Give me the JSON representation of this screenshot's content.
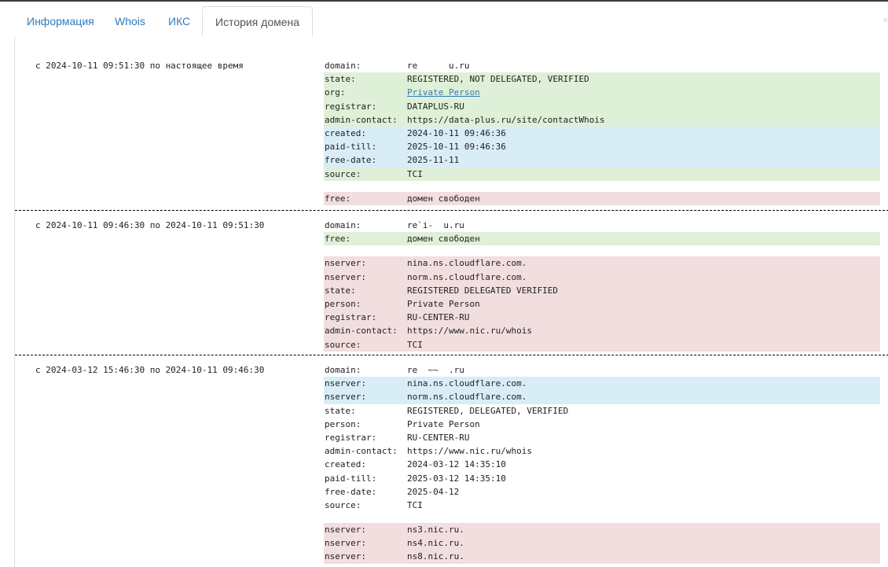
{
  "tabs": [
    {
      "label": "Информация",
      "active": false
    },
    {
      "label": "Whois",
      "active": false
    },
    {
      "label": "ИКС",
      "active": false
    },
    {
      "label": "История домена",
      "active": true
    }
  ],
  "close_label": "×",
  "colors": {
    "added": "#dff0d8",
    "changed": "#d9edf7",
    "removed": "#f2dede",
    "link": "#337ab7"
  },
  "periods": [
    {
      "range": "с 2024-10-11 09:51:30 по настоящее время",
      "groups": [
        {
          "rows": [
            {
              "key": "domain:",
              "value": "re      u.ru",
              "hl": ""
            },
            {
              "key": "state:",
              "value": "REGISTERED, NOT DELEGATED, VERIFIED",
              "hl": "g"
            },
            {
              "key": "org:",
              "value": "Private Person",
              "hl": "g",
              "link": true
            },
            {
              "key": "registrar:",
              "value": "DATAPLUS-RU",
              "hl": "g"
            },
            {
              "key": "admin-contact:",
              "value": "https://data-plus.ru/site/contactWhois",
              "hl": "g"
            },
            {
              "key": "created:",
              "value": "2024-10-11 09:46:36",
              "hl": "b"
            },
            {
              "key": "paid-till:",
              "value": "2025-10-11 09:46:36",
              "hl": "b"
            },
            {
              "key": "free-date:",
              "value": "2025-11-11",
              "hl": "b"
            },
            {
              "key": "source:",
              "value": "TCI",
              "hl": "g"
            }
          ]
        },
        {
          "rows": [
            {
              "key": "free:",
              "value": "домен свободен",
              "hl": "r"
            }
          ]
        }
      ]
    },
    {
      "range": "с 2024-10-11 09:46:30 по 2024-10-11 09:51:30",
      "groups": [
        {
          "rows": [
            {
              "key": "domain:",
              "value": "re`i-  u.ru",
              "hl": ""
            },
            {
              "key": "free:",
              "value": "домен свободен",
              "hl": "g"
            }
          ]
        },
        {
          "rows": [
            {
              "key": "nserver:",
              "value": "nina.ns.cloudflare.com.",
              "hl": "r"
            },
            {
              "key": "nserver:",
              "value": "norm.ns.cloudflare.com.",
              "hl": "r"
            },
            {
              "key": "state:",
              "value": "REGISTERED DELEGATED VERIFIED",
              "hl": "r"
            },
            {
              "key": "person:",
              "value": "Private Person",
              "hl": "r"
            },
            {
              "key": "registrar:",
              "value": "RU-CENTER-RU",
              "hl": "r"
            },
            {
              "key": "admin-contact:",
              "value": "https://www.nic.ru/whois",
              "hl": "r"
            },
            {
              "key": "source:",
              "value": "TCI",
              "hl": "r"
            }
          ]
        }
      ]
    },
    {
      "range": "с 2024-03-12 15:46:30 по 2024-10-11 09:46:30",
      "groups": [
        {
          "rows": [
            {
              "key": "domain:",
              "value": "re  ~~  .ru",
              "hl": ""
            },
            {
              "key": "nserver:",
              "value": "nina.ns.cloudflare.com.",
              "hl": "b"
            },
            {
              "key": "nserver:",
              "value": "norm.ns.cloudflare.com.",
              "hl": "b"
            },
            {
              "key": "state:",
              "value": "REGISTERED, DELEGATED, VERIFIED",
              "hl": ""
            },
            {
              "key": "person:",
              "value": "Private Person",
              "hl": ""
            },
            {
              "key": "registrar:",
              "value": "RU-CENTER-RU",
              "hl": ""
            },
            {
              "key": "admin-contact:",
              "value": "https://www.nic.ru/whois",
              "hl": ""
            },
            {
              "key": "created:",
              "value": "2024-03-12 14:35:10",
              "hl": ""
            },
            {
              "key": "paid-till:",
              "value": "2025-03-12 14:35:10",
              "hl": ""
            },
            {
              "key": "free-date:",
              "value": "2025-04-12",
              "hl": ""
            },
            {
              "key": "source:",
              "value": "TCI",
              "hl": ""
            }
          ]
        },
        {
          "rows": [
            {
              "key": "nserver:",
              "value": "ns3.nic.ru.",
              "hl": "r"
            },
            {
              "key": "nserver:",
              "value": "ns4.nic.ru.",
              "hl": "r"
            },
            {
              "key": "nserver:",
              "value": "ns8.nic.ru.",
              "hl": "r"
            }
          ]
        }
      ]
    }
  ]
}
